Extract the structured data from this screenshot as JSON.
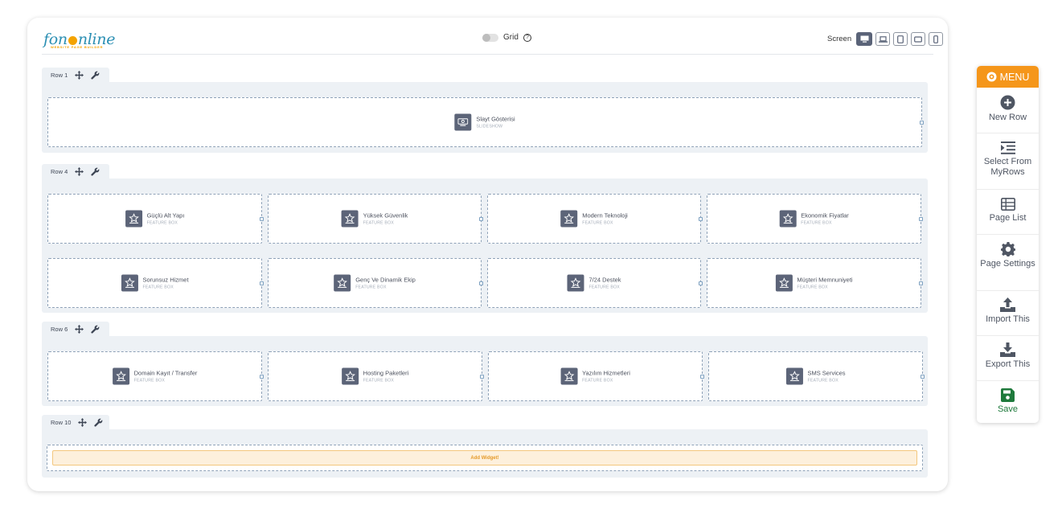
{
  "logo": {
    "text_a": "fon",
    "text_b": "nline",
    "subtitle": "WEBSITE PAGE BUILDER"
  },
  "toolbar": {
    "grid_label": "Grid",
    "screen_label": "Screen",
    "devices": [
      "desktop-icon",
      "laptop-icon",
      "tablet-icon",
      "tablet-landscape-icon",
      "mobile-icon"
    ]
  },
  "rows": [
    {
      "label": "Row 1",
      "widgets": [
        {
          "title": "Slayt Gösterisi",
          "type": "SLIDESHOW",
          "icon": "slideshow-icon"
        }
      ]
    },
    {
      "label": "Row 4",
      "widgets": [
        {
          "title": "Güçlü Alt Yapı",
          "type": "FEATURE BOX"
        },
        {
          "title": "Yüksek Güvenlik",
          "type": "FEATURE BOX"
        },
        {
          "title": "Modern Teknoloji",
          "type": "FEATURE BOX"
        },
        {
          "title": "Ekonomik Fiyatlar",
          "type": "FEATURE BOX"
        },
        {
          "title": "Sorunsuz Hizmet",
          "type": "FEATURE BOX"
        },
        {
          "title": "Genç Ve Dinamik Ekip",
          "type": "FEATURE BOX"
        },
        {
          "title": "7/24 Destek",
          "type": "FEATURE BOX"
        },
        {
          "title": "Müşteri Memnuniyeti",
          "type": "FEATURE BOX"
        }
      ]
    },
    {
      "label": "Row 6",
      "widgets": [
        {
          "title": "Domain Kayıt / Transfer",
          "type": "FEATURE BOX"
        },
        {
          "title": "Hosting Paketleri",
          "type": "FEATURE BOX"
        },
        {
          "title": "Yazılım Hizmetleri",
          "type": "FEATURE BOX"
        },
        {
          "title": "SMS Services",
          "type": "FEATURE BOX"
        }
      ]
    },
    {
      "label": "Row 10",
      "add_widget": "Add Widget!"
    }
  ],
  "menu": {
    "header": "MENU",
    "items": [
      {
        "label": "New Row",
        "icon": "plus-circle-icon"
      },
      {
        "label": "Select From MyRows",
        "icon": "indent-list-icon"
      },
      {
        "label": "Page List",
        "icon": "table-list-icon"
      },
      {
        "label": "Page Settings",
        "icon": "gear-icon"
      },
      {
        "label": "Import This",
        "icon": "upload-icon"
      },
      {
        "label": "Export This",
        "icon": "download-icon"
      },
      {
        "label": "Save",
        "icon": "save-icon"
      }
    ]
  },
  "colors": {
    "accent": "#f5961a",
    "widget_icon_bg": "#5c6478",
    "row_bg": "#edf1f5",
    "save": "#1f7a3c"
  }
}
